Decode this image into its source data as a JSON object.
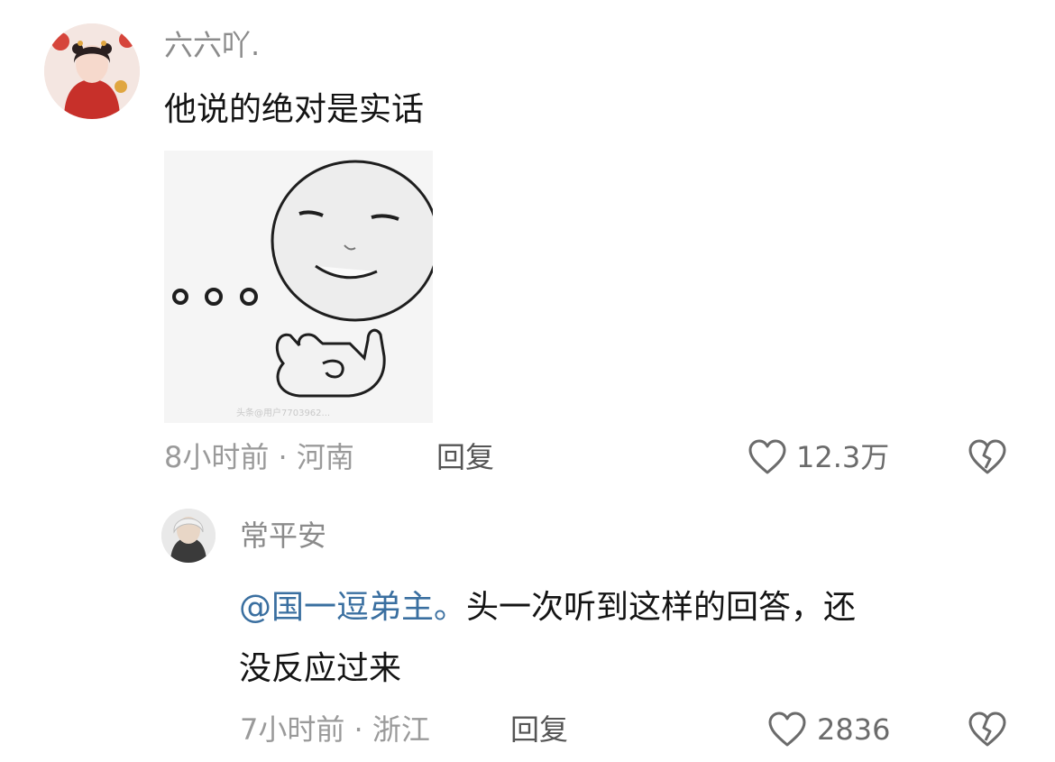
{
  "comment": {
    "username": "六六吖.",
    "text": "他说的绝对是实话",
    "meta": "8小时前 · 河南",
    "reply_label": "回复",
    "like_count": "12.3万",
    "image_watermark": "头条@用户7703962..."
  },
  "reply": {
    "username": "常平安",
    "mention": "@国一逗弟主。",
    "text_line1": "头一次听到这样的回答，还",
    "text_line2": "没反应过来",
    "meta": "7小时前 · 浙江",
    "reply_label": "回复",
    "like_count": "2836"
  },
  "icons": {
    "like": "heart-outline-icon",
    "dislike": "broken-heart-icon"
  },
  "colors": {
    "mention": "#3a6fa0",
    "text": "#141414",
    "muted": "#9a9a9a"
  }
}
